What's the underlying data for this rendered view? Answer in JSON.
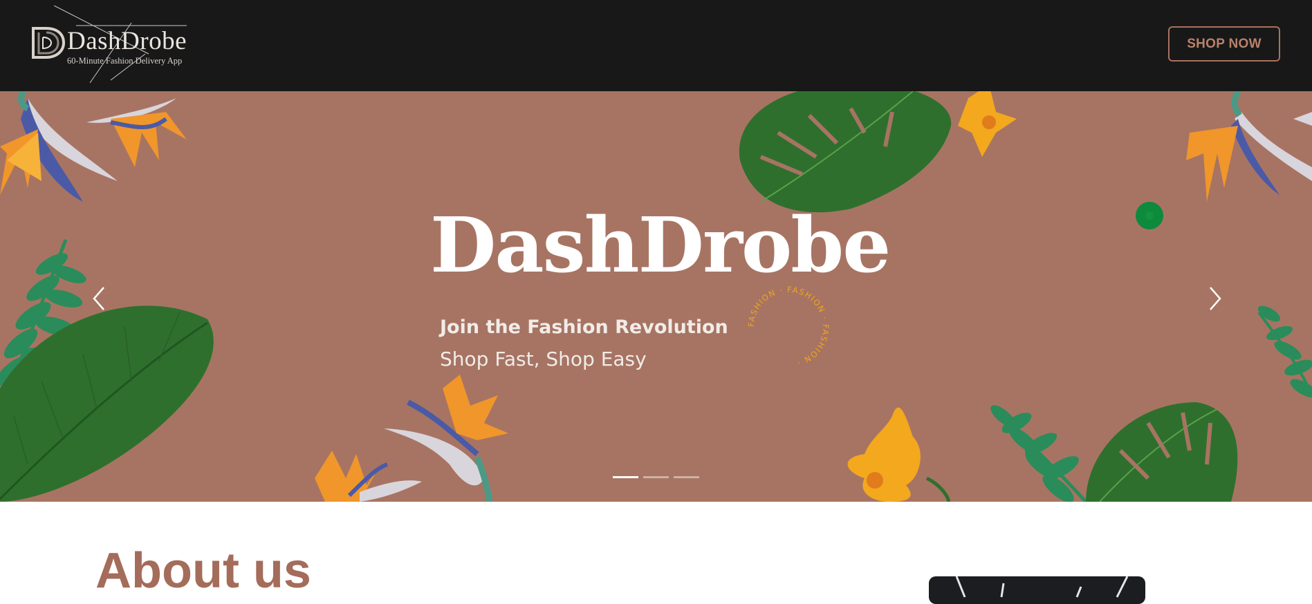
{
  "header": {
    "logo_name": "DashDrobe",
    "logo_tagline": "60-Minute Fashion Delivery App",
    "shop_button": "SHOP NOW"
  },
  "hero": {
    "title": "DashDrobe",
    "subtitle": "Join the Fashion Revolution",
    "tagline": "Shop Fast, Shop Easy",
    "badge_text": "FASHION · FASHION · FASHION · ",
    "prev_icon": "chevron-left-icon",
    "next_icon": "chevron-right-icon",
    "slide_count": 3,
    "active_slide": 1
  },
  "about": {
    "title": "About us"
  },
  "colors": {
    "header_bg": "#181818",
    "hero_bg": "#a77463",
    "accent": "#a46c5a",
    "leaf_dark": "#2f6f2e",
    "leaf_teal": "#2a8c5a",
    "flower_orange": "#f0962a",
    "flower_yellow": "#f3a81e"
  }
}
